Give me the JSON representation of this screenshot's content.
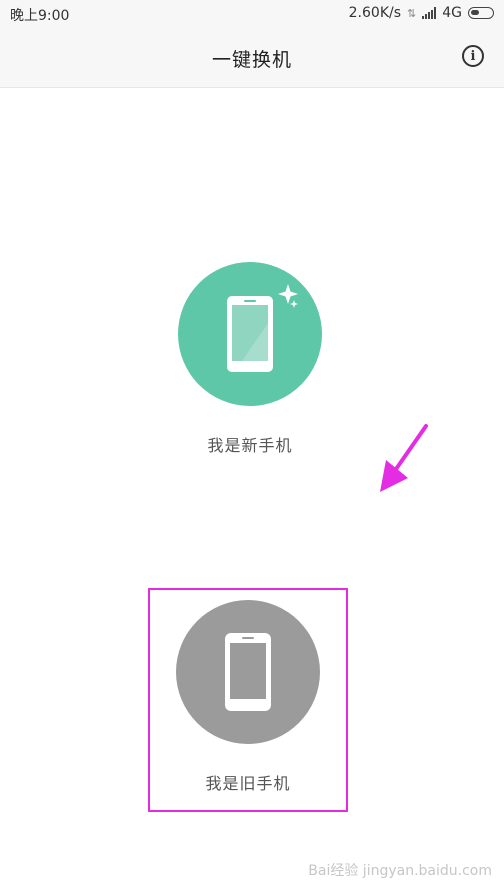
{
  "status_bar": {
    "time": "晚上9:00",
    "speed": "2.60K/s",
    "network": "4G"
  },
  "header": {
    "title": "一键换机",
    "info_icon": "info-icon"
  },
  "options": [
    {
      "label": "我是新手机",
      "icon": "new-phone-icon",
      "color": "#5ec7a8"
    },
    {
      "label": "我是旧手机",
      "icon": "old-phone-icon",
      "color": "#9b9b9b"
    }
  ],
  "annotation": {
    "highlight_color": "#e32ce3"
  },
  "watermark": "Bai经验 jingyan.baidu.com"
}
